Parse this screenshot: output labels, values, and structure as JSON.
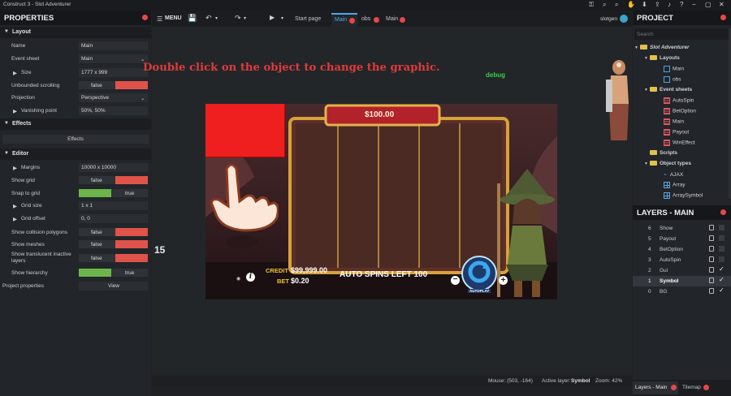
{
  "titlebar": {
    "title": "Construct 3 - Slot Adventurer"
  },
  "properties": {
    "title": "PROPERTIES",
    "sections": {
      "layout": "Layout",
      "effects": "Effects",
      "editor": "Editor"
    },
    "rows": {
      "name": {
        "label": "Name",
        "value": "Main"
      },
      "event_sheet": {
        "label": "Event sheet",
        "value": "Main"
      },
      "size": {
        "label": "Size",
        "value": "1777 x 999"
      },
      "unbounded": {
        "label": "Unbounded scrolling",
        "value": "false"
      },
      "projection": {
        "label": "Projection",
        "value": "Perspective"
      },
      "vanishing": {
        "label": "Vanishing point",
        "value": "50%, 50%"
      },
      "effects_btn": "Effects",
      "margins": {
        "label": "Margins",
        "value": "10000 x 10000"
      },
      "show_grid": {
        "label": "Show grid",
        "value": "false"
      },
      "snap_grid": {
        "label": "Snap to grid",
        "value": "true"
      },
      "grid_size": {
        "label": "Grid size",
        "value": "1 x 1"
      },
      "grid_offset": {
        "label": "Grid offset",
        "value": "0, 0"
      },
      "show_collision": {
        "label": "Show collision polygons",
        "value": "false"
      },
      "show_meshes": {
        "label": "Show meshes",
        "value": "false"
      },
      "show_translucent": {
        "label": "Show translucent inactive layers",
        "value": "false"
      },
      "show_hierarchy": {
        "label": "Show hierarchy",
        "value": "true"
      },
      "project_props": {
        "label": "Project properties",
        "value": "View"
      }
    }
  },
  "toolbar": {
    "menu": "MENU",
    "tabs": [
      "Start page",
      "Main",
      "obs",
      "Main"
    ],
    "user": "slotgen"
  },
  "canvas": {
    "instruction": "Double click on the object to change the graphic.",
    "debug": "debug",
    "number": "15",
    "jackpot": "$100.00",
    "credit_label": "CREDIT",
    "credit_value": "$99,999.00",
    "bet_label": "BET",
    "bet_value": "$0.20",
    "auto_spins": "AUTO SPINS LEFT 100",
    "autoplay": "AUTOPLAY",
    "info": "i",
    "minus": "−",
    "plus": "+"
  },
  "status": {
    "mouse": "Mouse: (503, -164)",
    "active_layer_label": "Active layer: ",
    "active_layer": "Symbol",
    "zoom": "Zoom: 42%"
  },
  "project": {
    "title": "PROJECT",
    "search_placeholder": "Search",
    "root": "Slot Adventurer",
    "layouts": "Layouts",
    "layout_items": [
      "Main",
      "obs"
    ],
    "event_sheets": "Event sheets",
    "event_items": [
      "AutoSpin",
      "BetOption",
      "Main",
      "Payout",
      "WinEffect"
    ],
    "scripts": "Scripts",
    "object_types": "Object types",
    "object_items": [
      "AJAX",
      "Array",
      "ArraySymbol"
    ]
  },
  "layers": {
    "title": "LAYERS - MAIN",
    "items": [
      {
        "n": "6",
        "name": "Show"
      },
      {
        "n": "5",
        "name": "Payout"
      },
      {
        "n": "4",
        "name": "BetOption"
      },
      {
        "n": "3",
        "name": "AutoSpin"
      },
      {
        "n": "2",
        "name": "Gui"
      },
      {
        "n": "1",
        "name": "Symbol"
      },
      {
        "n": "0",
        "name": "BG"
      }
    ]
  },
  "bottom_tabs": [
    "Layers - Main",
    "Tilemap"
  ],
  "colors": {
    "accent": "#e54848",
    "active_tab": "#4ea6e8",
    "toggle_red": "#e0534a",
    "toggle_green": "#6cb54a"
  }
}
